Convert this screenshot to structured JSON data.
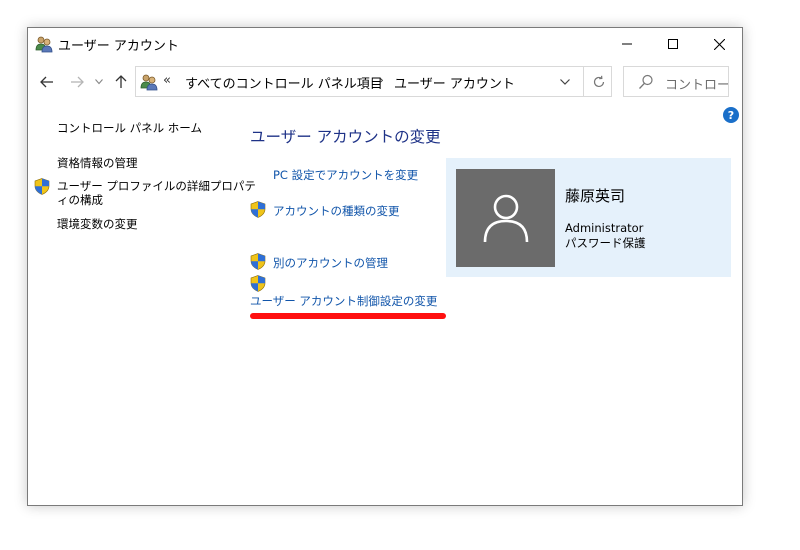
{
  "window": {
    "title": "ユーザー アカウント"
  },
  "address": {
    "overflow_marker": "«",
    "segment1": "すべてのコントロール パネル項目",
    "separator": "›",
    "segment2": "ユーザー アカウント"
  },
  "search": {
    "placeholder": "コントロー..."
  },
  "help": {
    "label": "?"
  },
  "sidebar": {
    "home": "コントロール パネル ホーム",
    "items": [
      {
        "label": "資格情報の管理",
        "shield": false
      },
      {
        "label_line1": "ユーザー プロファイルの詳細プロパテ",
        "label_line2": "ィの構成",
        "shield": true
      },
      {
        "label": "環境変数の変更",
        "shield": false
      }
    ]
  },
  "main": {
    "title": "ユーザー アカウントの変更",
    "tasks": [
      {
        "label": "PC 設定でアカウントを変更",
        "shield": false
      },
      {
        "label": "アカウントの種類の変更",
        "shield": true
      },
      {
        "label": "別のアカウントの管理",
        "shield": true
      },
      {
        "label": "ユーザー アカウント制御設定の変更",
        "shield": true
      }
    ]
  },
  "account": {
    "name": "藤原英司",
    "role": "Administrator",
    "password_status": "パスワード保護"
  },
  "colors": {
    "link": "#1155aa",
    "title": "#1e3287",
    "panel_bg": "#e5f1fb",
    "avatar_bg": "#6b6b6b",
    "highlight": "#ff1010"
  }
}
